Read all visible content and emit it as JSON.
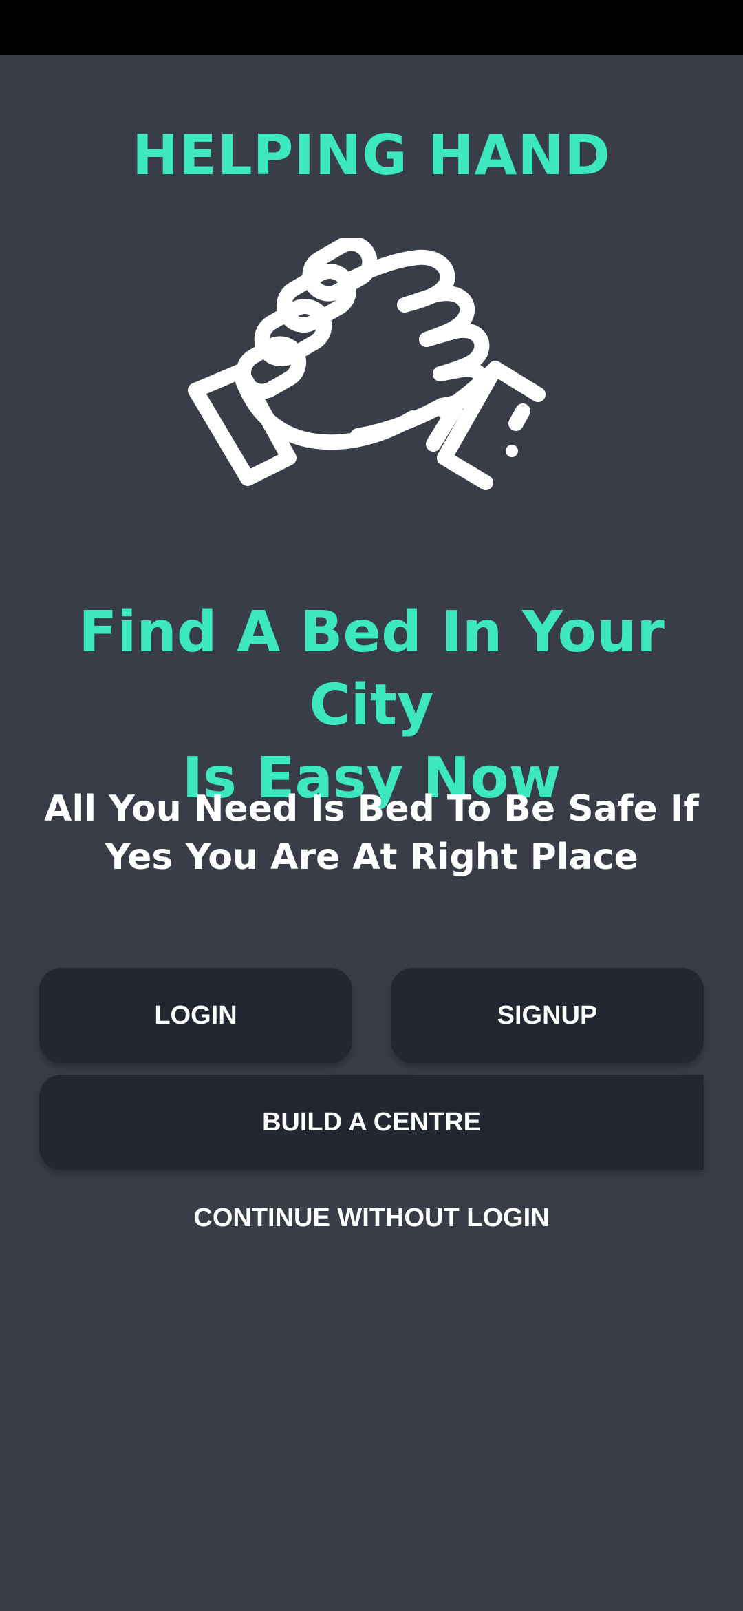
{
  "app": {
    "title": "HELPING HAND"
  },
  "logo": {
    "icon": "handshake-icon"
  },
  "hero": {
    "headline_line1": "Find A Bed In Your City",
    "headline_line2": "Is Easy Now",
    "subheading_line1": "All You Need Is Bed To Be Safe If",
    "subheading_line2": "Yes You Are At Right Place"
  },
  "actions": {
    "login_label": "LOGIN",
    "signup_label": "SIGNUP",
    "build_centre_label": "BUILD A CENTRE",
    "continue_label": "CONTINUE WITHOUT LOGIN"
  },
  "colors": {
    "background": "#393d47",
    "accent": "#3de8c0",
    "button": "#222731",
    "text": "#ffffff"
  }
}
